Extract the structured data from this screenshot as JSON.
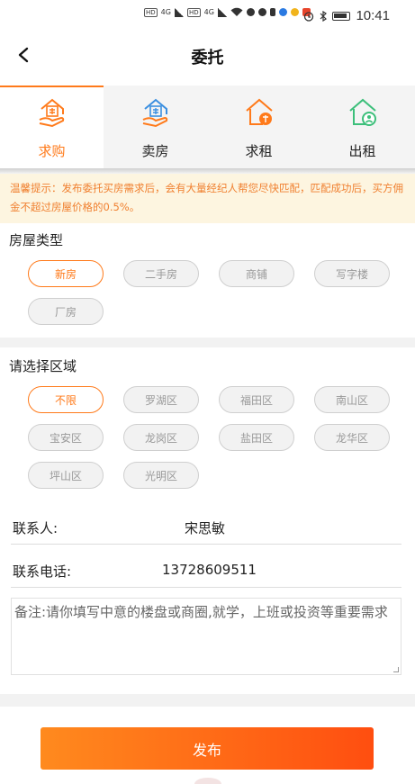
{
  "status_bar": {
    "left_icons": [
      "HD",
      "4G",
      "HD",
      "4G",
      "wifi-icon",
      "wechat-icon",
      "chat-icon",
      "app-icon",
      "notification-icon",
      "app2-icon"
    ],
    "hd1": "HD",
    "sig1": "4G",
    "hd2": "HD",
    "sig2": "4G",
    "time": "10:41"
  },
  "nav": {
    "title": "委托"
  },
  "tabs": [
    {
      "label": "求购",
      "icon": "buy-house-icon",
      "active": true
    },
    {
      "label": "卖房",
      "icon": "sell-house-icon",
      "active": false
    },
    {
      "label": "求租",
      "icon": "rent-seek-icon",
      "active": false
    },
    {
      "label": "出租",
      "icon": "rent-out-icon",
      "active": false
    }
  ],
  "notice": "温馨提示：发布委托买房需求后，会有大量经纪人帮您尽快匹配，匹配成功后，买方佣金不超过房屋价格的0.5%。",
  "house_type": {
    "title": "房屋类型",
    "options": [
      "新房",
      "二手房",
      "商铺",
      "写字楼",
      "厂房"
    ],
    "selected": "新房"
  },
  "region": {
    "title": "请选择区域",
    "options": [
      "不限",
      "罗湖区",
      "福田区",
      "南山区",
      "宝安区",
      "龙岗区",
      "盐田区",
      "龙华区",
      "坪山区",
      "光明区"
    ],
    "selected": "不限"
  },
  "contact": {
    "name_label": "联系人:",
    "name_value": "宋思敏",
    "phone_label": "联系电话:",
    "phone_value": "13728609511"
  },
  "remark": {
    "placeholder": "备注:请你填写中意的楼盘或商圈,就学，上班或投资等重要需求"
  },
  "publish_button": "发布",
  "colors": {
    "accent": "#ff7a1a",
    "notice_bg": "#fdf5e0",
    "notice_text": "#f08030",
    "blue_icon": "#3b8fe0",
    "green_icon": "#3cbf7a"
  }
}
